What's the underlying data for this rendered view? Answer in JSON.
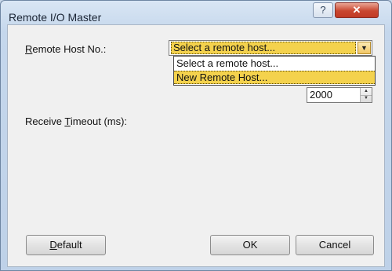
{
  "window": {
    "title": "Remote I/O Master",
    "help_glyph": "?",
    "close_glyph": "✕"
  },
  "form": {
    "remote_host": {
      "label_accel": "R",
      "label_rest": "emote Host No.:",
      "value": "Select a remote host...",
      "options": [
        "Select a remote host...",
        "New Remote Host..."
      ],
      "highlighted_index": 1
    },
    "timeout": {
      "label_pre": "Receive ",
      "label_accel": "T",
      "label_rest": "imeout (ms):",
      "value": "2000"
    }
  },
  "buttons": {
    "default_accel": "D",
    "default_rest": "efault",
    "ok": "OK",
    "cancel": "Cancel"
  },
  "colors": {
    "highlight": "#f4d24d",
    "close_button": "#c9462f"
  }
}
